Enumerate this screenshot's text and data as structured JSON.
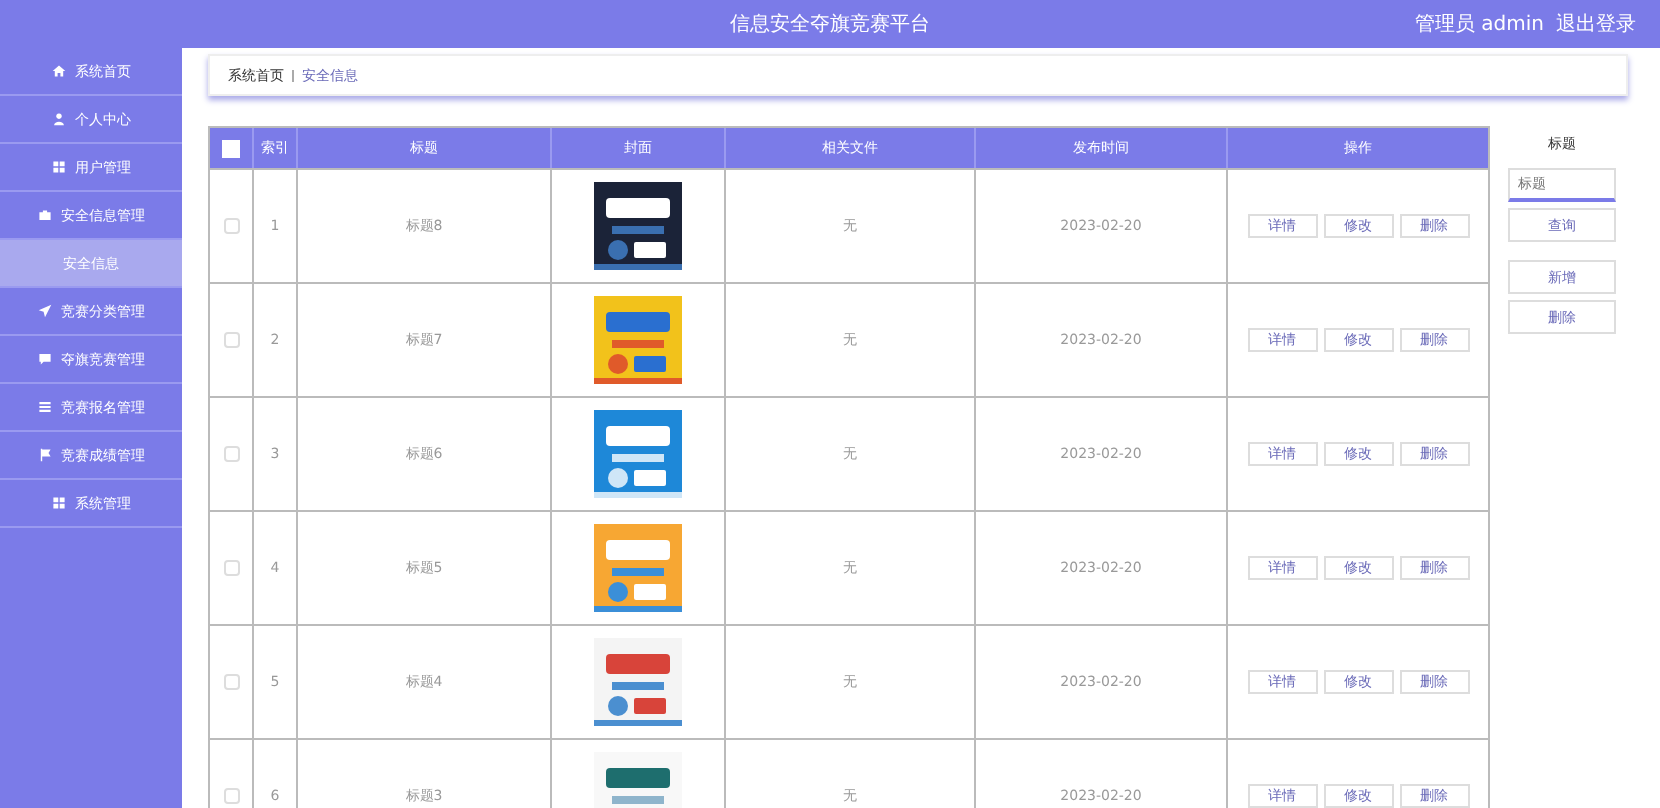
{
  "header": {
    "title": "信息安全夺旗竞赛平台",
    "user": "管理员 admin",
    "logout": "退出登录"
  },
  "sidebar": {
    "items": [
      {
        "label": "系统首页",
        "selected": false
      },
      {
        "label": "个人中心",
        "selected": false
      },
      {
        "label": "用户管理",
        "selected": false
      },
      {
        "label": "安全信息管理",
        "selected": false,
        "children": [
          {
            "label": "安全信息",
            "selected": true
          }
        ]
      },
      {
        "label": "竞赛分类管理",
        "selected": false
      },
      {
        "label": "夺旗竞赛管理",
        "selected": false
      },
      {
        "label": "竞赛报名管理",
        "selected": false
      },
      {
        "label": "竞赛成绩管理",
        "selected": false
      },
      {
        "label": "系统管理",
        "selected": false
      }
    ]
  },
  "breadcrumb": [
    "系统首页",
    "安全信息"
  ],
  "table": {
    "select_all": false,
    "columns": [
      "索引",
      "标题",
      "封面",
      "相关文件",
      "发布时间",
      "操作"
    ],
    "rows": [
      {
        "checked": false,
        "index": "1",
        "title": "标题8",
        "file": "无",
        "date": "2023-02-20",
        "actions": [
          "详情",
          "修改",
          "删除"
        ]
      },
      {
        "checked": false,
        "index": "2",
        "title": "标题7",
        "file": "无",
        "date": "2023-02-20",
        "actions": [
          "详情",
          "修改",
          "删除"
        ]
      },
      {
        "checked": false,
        "index": "3",
        "title": "标题6",
        "file": "无",
        "date": "2023-02-20",
        "actions": [
          "详情",
          "修改",
          "删除"
        ]
      },
      {
        "checked": false,
        "index": "4",
        "title": "标题5",
        "file": "无",
        "date": "2023-02-20",
        "actions": [
          "详情",
          "修改",
          "删除"
        ]
      },
      {
        "checked": false,
        "index": "5",
        "title": "标题4",
        "file": "无",
        "date": "2023-02-20",
        "actions": [
          "详情",
          "修改",
          "删除"
        ]
      },
      {
        "checked": false,
        "index": "6",
        "title": "标题3",
        "file": "无",
        "date": "2023-02-20",
        "actions": [
          "详情",
          "修改",
          "删除"
        ]
      }
    ]
  },
  "search": {
    "label": "标题",
    "placeholder": "标题",
    "query_button": "查询",
    "add_button": "新增",
    "delete_button": "删除"
  }
}
